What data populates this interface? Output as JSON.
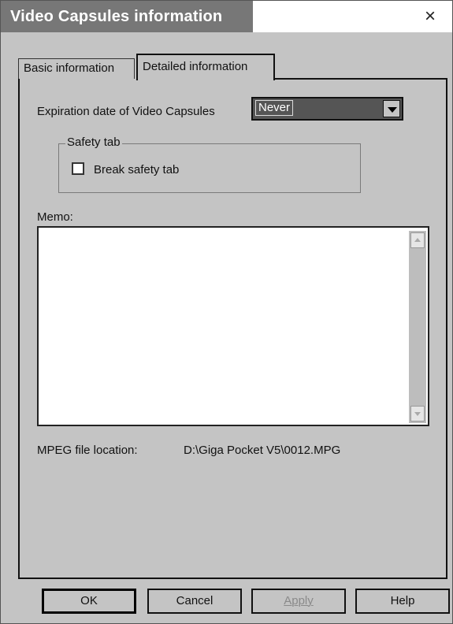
{
  "window": {
    "title": "Video Capsules information",
    "close_glyph": "×"
  },
  "tabs": [
    {
      "label": "Basic information",
      "active": false
    },
    {
      "label": "Detailed information",
      "active": true
    }
  ],
  "expiration": {
    "label": "Expiration date of Video Capsules",
    "selected": "Never"
  },
  "safety": {
    "group_label": "Safety tab",
    "checkbox_label": "Break safety tab",
    "checked": false
  },
  "memo": {
    "label": "Memo:",
    "value": ""
  },
  "mpeg": {
    "label": "MPEG file location:",
    "value": "D:\\Giga Pocket V5\\0012.MPG"
  },
  "buttons": {
    "ok": "OK",
    "cancel": "Cancel",
    "apply": "Apply",
    "help": "Help"
  },
  "icons": {
    "close": "close-icon",
    "dropdown": "chevron-down-icon",
    "scroll_up": "scroll-up-icon",
    "scroll_down": "scroll-down-icon"
  }
}
